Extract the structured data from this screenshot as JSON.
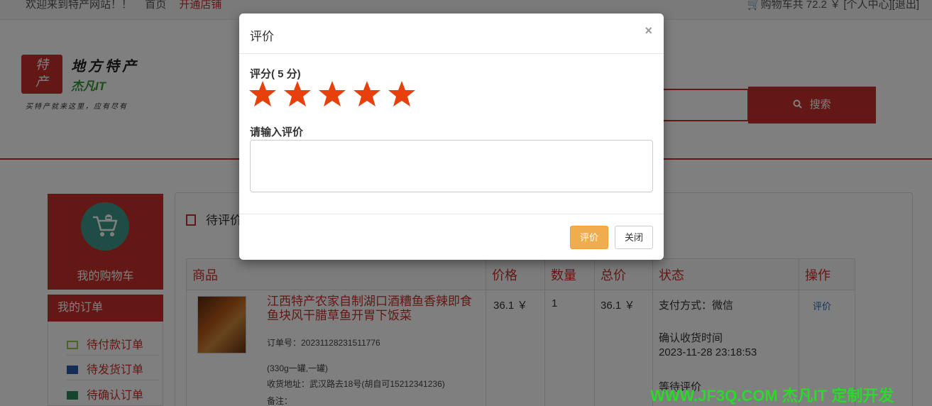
{
  "topbar": {
    "welcome": "欢迎来到特产网站！！",
    "home": "首页",
    "open_shop": "开通店铺",
    "cart_summary": "购物车共 72.2 ￥",
    "user_center": "[个人中心]",
    "logout": "[退出]"
  },
  "logo": {
    "box_text_1": "特",
    "box_text_2": "产",
    "title": "地方特产",
    "brand": "杰凡IT",
    "slogan": "买特产就来这里，应有尽有"
  },
  "search": {
    "button_label": "搜索"
  },
  "sidebar": {
    "cart_label": "我的购物车",
    "orders_title": "我的订单",
    "items": [
      {
        "label": "待付款订单"
      },
      {
        "label": "待发货订单"
      },
      {
        "label": "待确认订单"
      }
    ]
  },
  "main": {
    "title": "待评价",
    "table": {
      "headers": [
        "商品",
        "价格",
        "数量",
        "总价",
        "状态",
        "操作"
      ],
      "row": {
        "name": "江西特产农家自制湖口酒糟鱼香辣即食鱼块风干腊草鱼开胃下饭菜",
        "order_no": "订单号：20231128231511776",
        "spec": "(330g一罐,一罐)",
        "address": "收货地址：武汉路去18号(胡自可15212341236)",
        "note": "备注：",
        "price": "36.1 ￥",
        "qty": "1",
        "total": "36.1 ￥",
        "pay": "支付方式：微信",
        "confirm_label": "确认收货时间",
        "confirm_time": "2023-11-28 23:18:53",
        "status": "等待评价",
        "action": "评价"
      }
    }
  },
  "modal": {
    "title": "评价",
    "close_symbol": "×",
    "rating_label": "评分( 5 分)",
    "rating": 5,
    "rating_max": 5,
    "star_color": "#e8400c",
    "comment_label": "请输入评价",
    "comment_value": "",
    "submit_label": "评价",
    "close_label": "关闭"
  },
  "watermark": "WWW.JF3Q.COM 杰凡IT 定制开发",
  "colors": {
    "brand_red": "#c9302c",
    "submit_orange": "#f0ad4e",
    "watermark_green": "#2bd92b"
  }
}
